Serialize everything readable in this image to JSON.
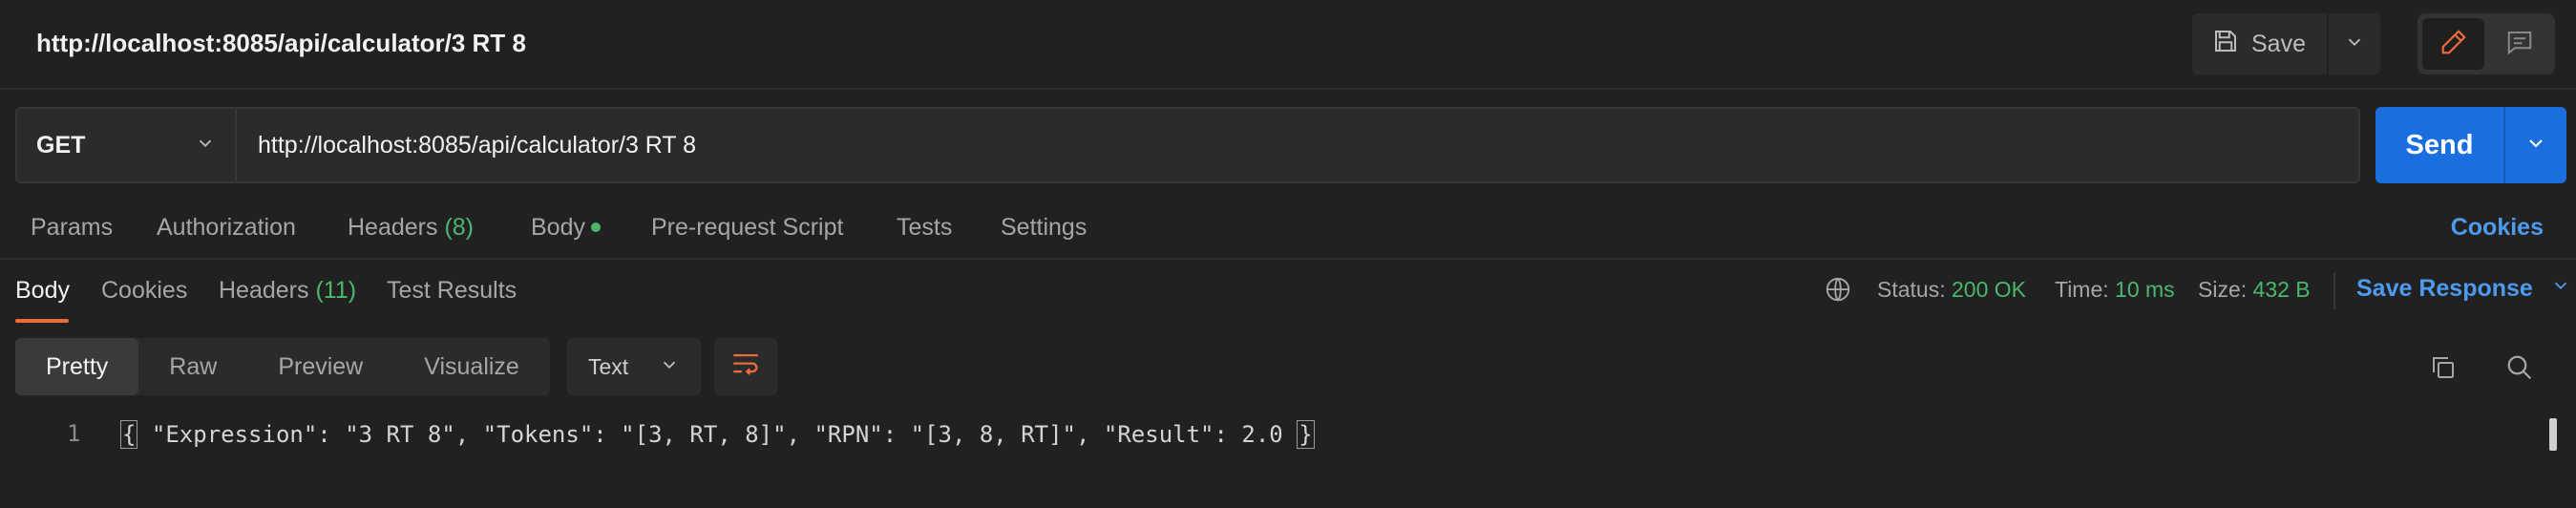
{
  "request": {
    "title": "http://localhost:8085/api/calculator/3 RT 8",
    "save_label": "Save",
    "method": "GET",
    "url": "http://localhost:8085/api/calculator/3 RT 8",
    "send_label": "Send"
  },
  "request_tabs": {
    "params": "Params",
    "authorization": "Authorization",
    "headers": "Headers",
    "headers_count": "(8)",
    "body": "Body",
    "pre_request": "Pre-request Script",
    "tests": "Tests",
    "settings": "Settings",
    "cookies": "Cookies"
  },
  "response_tabs": {
    "body": "Body",
    "cookies": "Cookies",
    "headers": "Headers",
    "headers_count": "(11)",
    "test_results": "Test Results"
  },
  "status": {
    "status_label": "Status:",
    "status_value": "200 OK",
    "time_label": "Time:",
    "time_value": "10 ms",
    "size_label": "Size:",
    "size_value": "432 B",
    "save_response": "Save Response"
  },
  "view": {
    "modes": [
      "Pretty",
      "Raw",
      "Preview",
      "Visualize"
    ],
    "active_mode": "Pretty",
    "format": "Text"
  },
  "code": {
    "line_number": "1",
    "text": " \"Expression\": \"3 RT 8\", \"Tokens\": \"[3, RT, 8]\", \"RPN\": \"[3, 8, RT]\", \"Result\": 2.0 "
  },
  "colors": {
    "background": "#212121",
    "accent_blue": "#1a6fe0",
    "link_blue": "#4d9bef",
    "success_green": "#49b86d",
    "active_orange": "#f26b3a"
  },
  "icons": [
    "save-icon",
    "chevron-down-icon",
    "pencil-icon",
    "comment-icon",
    "globe-icon",
    "wrap-lines-icon",
    "copy-icon",
    "search-icon"
  ]
}
